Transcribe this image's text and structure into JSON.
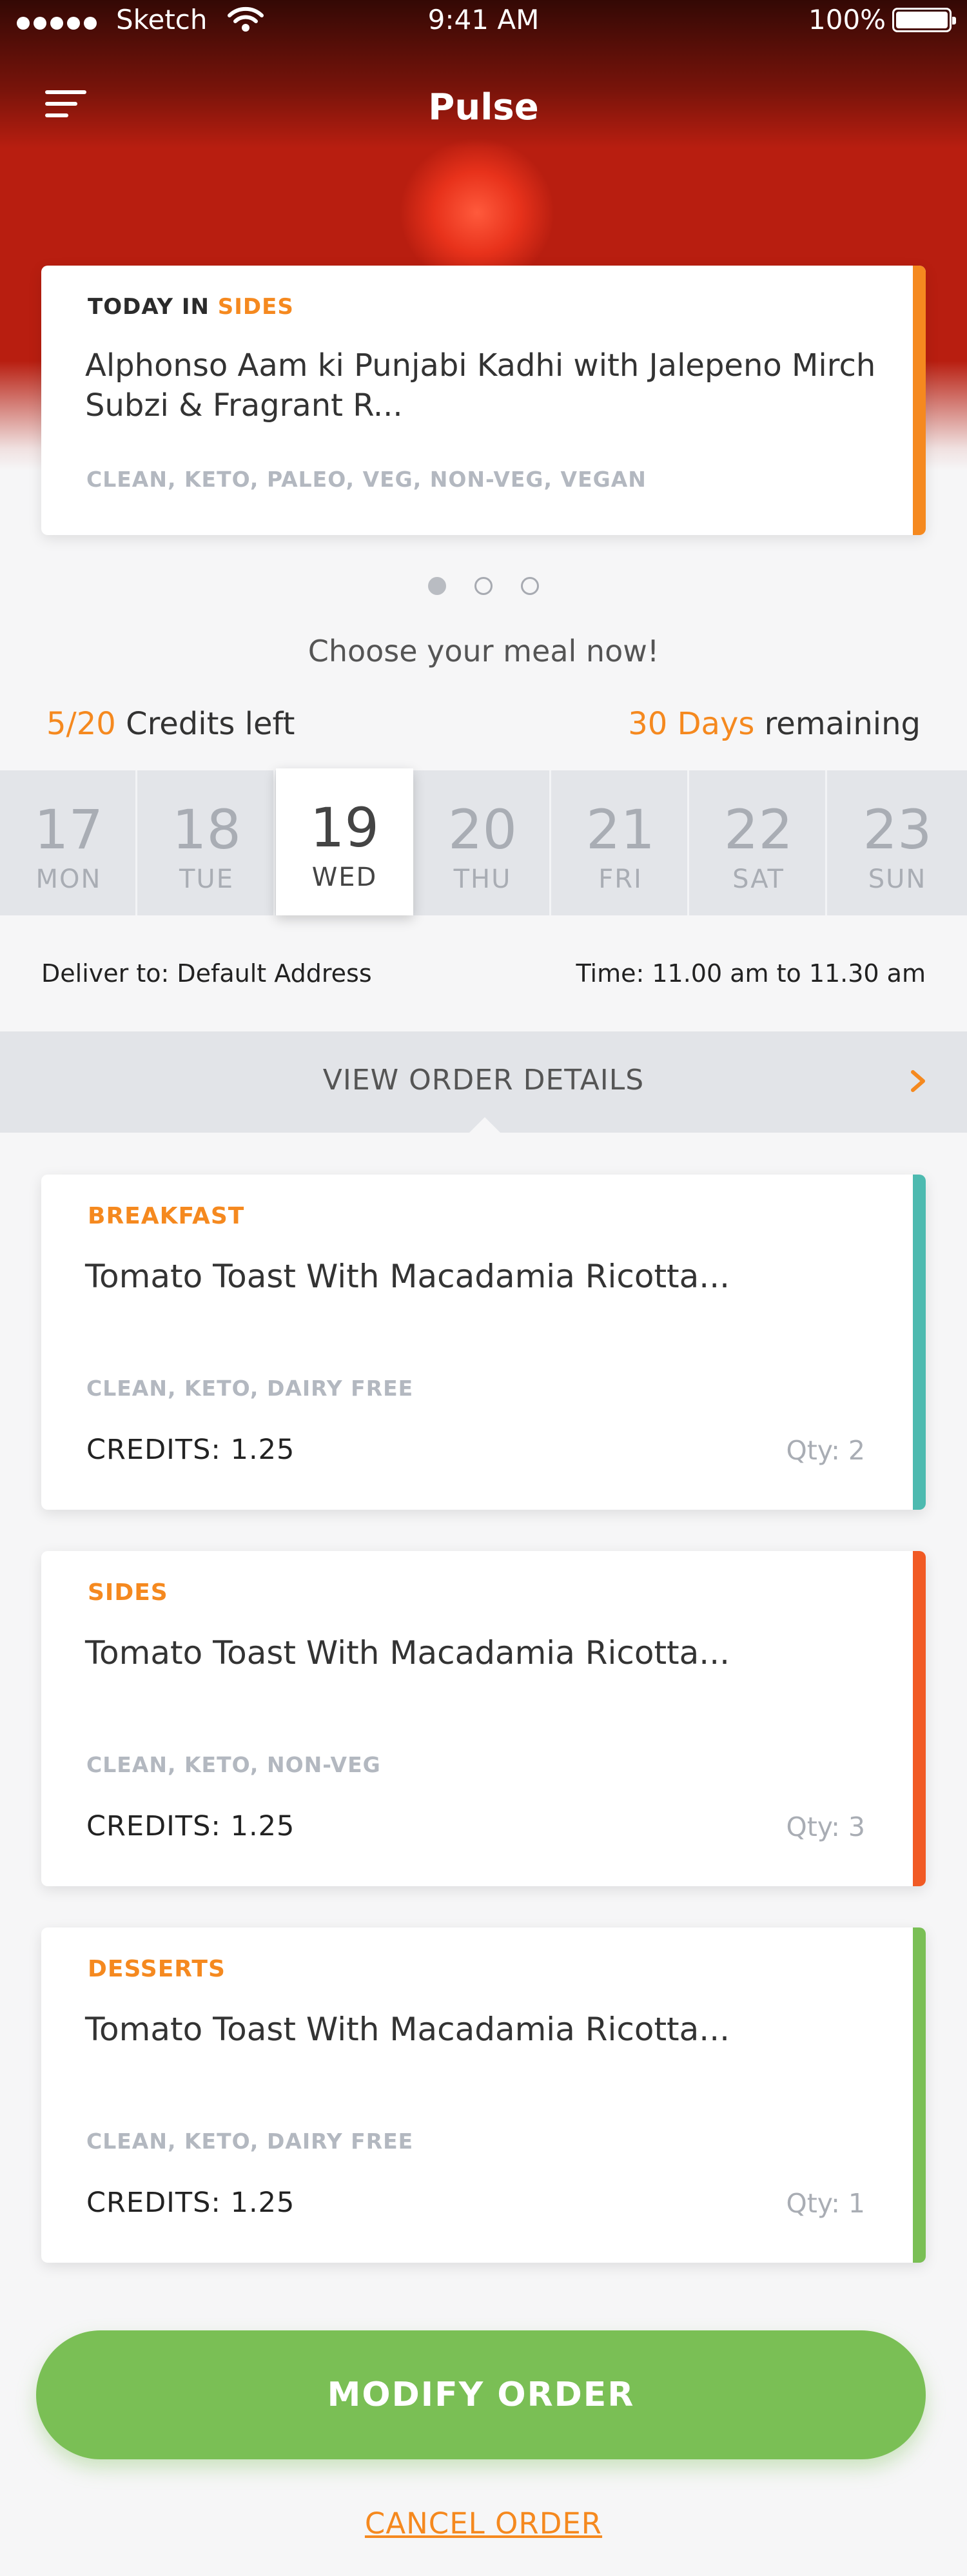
{
  "status_bar": {
    "carrier": "Sketch",
    "time": "9:41 AM",
    "battery": "100%"
  },
  "header": {
    "title": "Pulse",
    "menu_icon": "hamburger-icon"
  },
  "featured": {
    "label_prefix": "TODAY IN",
    "label_category": "SIDES",
    "title": "Alphonso Aam ki Punjabi Kadhi with Jalepeno Mirch Subzi & Fragrant R...",
    "tags": "CLEAN, KETO, PALEO, VEG, NON-VEG, VEGAN",
    "accent_color": "#f5891f"
  },
  "carousel": {
    "pages": 3,
    "active_index": 0
  },
  "choose_text": "Choose your meal now!",
  "credits": {
    "value": "5/20",
    "label": "Credits left"
  },
  "days_remaining": {
    "value": "30 Days",
    "label": "remaining"
  },
  "days": [
    {
      "num": "17",
      "name": "MON",
      "selected": false
    },
    {
      "num": "18",
      "name": "TUE",
      "selected": false
    },
    {
      "num": "19",
      "name": "WED",
      "selected": true
    },
    {
      "num": "20",
      "name": "THU",
      "selected": false
    },
    {
      "num": "21",
      "name": "FRI",
      "selected": false
    },
    {
      "num": "22",
      "name": "SAT",
      "selected": false
    },
    {
      "num": "23",
      "name": "SUN",
      "selected": false
    }
  ],
  "delivery": {
    "address": "Deliver to: Default Address",
    "time": "Time: 11.00 am to 11.30 am"
  },
  "view_order": {
    "label": "VIEW ORDER DETAILS",
    "icon": "chevron-right-icon"
  },
  "meals": [
    {
      "category": "BREAKFAST",
      "title": "Tomato Toast With Macadamia Ricotta...",
      "tags": "CLEAN, KETO, DAIRY FREE",
      "credits": "CREDITS: 1.25",
      "qty": "Qty: 2",
      "accent_color": "#4dbab0"
    },
    {
      "category": "SIDES",
      "title": "Tomato Toast With Macadamia Ricotta...",
      "tags": "CLEAN, KETO, NON-VEG",
      "credits": "CREDITS: 1.25",
      "qty": "Qty: 3",
      "accent_color": "#f15a24"
    },
    {
      "category": "DESSERTS",
      "title": "Tomato Toast With Macadamia Ricotta...",
      "tags": "CLEAN, KETO, DAIRY FREE",
      "credits": "CREDITS: 1.25",
      "qty": "Qty: 1",
      "accent_color": "#7abf55"
    }
  ],
  "actions": {
    "modify": "MODIFY ORDER",
    "cancel": "CANCEL ORDER"
  },
  "colors": {
    "orange": "#f5891f",
    "green": "#7abf55",
    "teal": "#4dbab0",
    "red_orange": "#f15a24"
  }
}
